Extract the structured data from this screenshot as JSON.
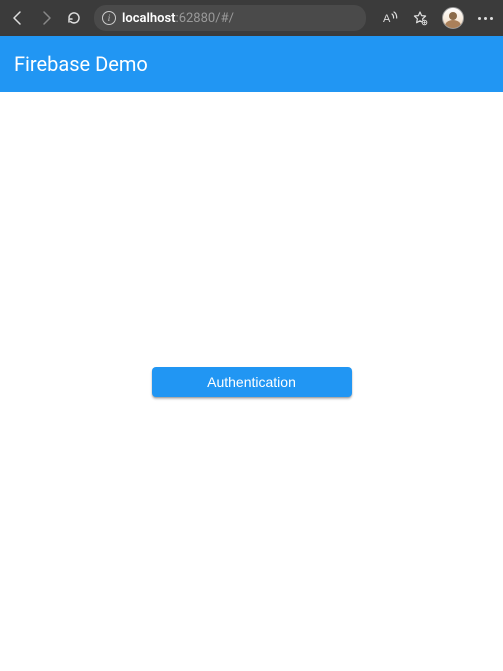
{
  "browser": {
    "url_host_strong": "localhost",
    "url_host_port": ":62880",
    "url_path": "/#/"
  },
  "app": {
    "title": "Firebase Demo"
  },
  "buttons": {
    "authentication": "Authentication"
  }
}
